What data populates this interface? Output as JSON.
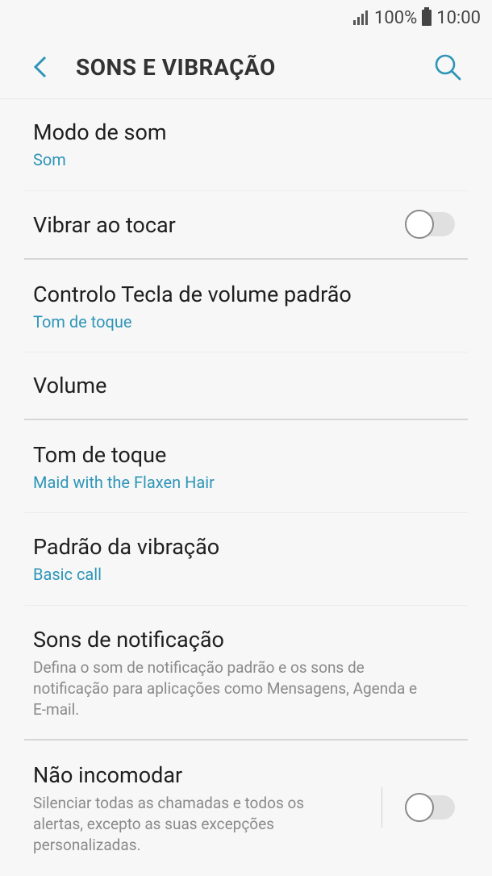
{
  "status_bar": {
    "battery_percent": "100%",
    "time": "10:00"
  },
  "header": {
    "title": "SONS E VIBRAÇÃO",
    "back_icon": "chevron-left-icon",
    "search_icon": "search-icon"
  },
  "accent_color": "#2e95b7",
  "items": [
    {
      "title": "Modo de som",
      "subtitle": "Som"
    },
    {
      "title": "Vibrar ao tocar",
      "toggle": false
    },
    {
      "title": "Controlo Tecla de volume padrão",
      "subtitle": "Tom de toque"
    },
    {
      "title": "Volume"
    },
    {
      "title": "Tom de toque",
      "subtitle": "Maid with the Flaxen Hair"
    },
    {
      "title": "Padrão da vibração",
      "subtitle": "Basic call"
    },
    {
      "title": "Sons de notificação",
      "description": "Defina o som de notificação padrão e os sons de notificação para aplicações como Mensagens, Agenda e E-mail."
    },
    {
      "title": "Não incomodar",
      "description": "Silenciar todas as chamadas e todos os alertas, excepto as suas excepções personalizadas.",
      "toggle": false
    }
  ]
}
